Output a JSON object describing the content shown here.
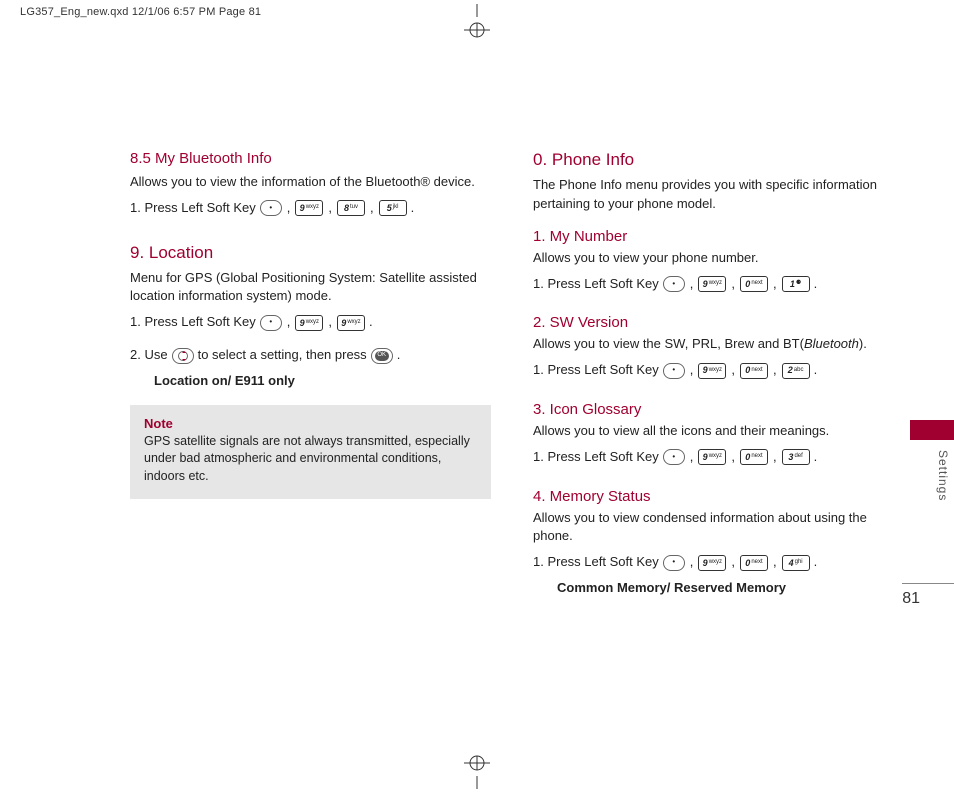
{
  "header": "LG357_Eng_new.qxd  12/1/06  6:57 PM  Page 81",
  "page_number": "81",
  "side_label": "Settings",
  "press_left": "1. Press Left Soft Key",
  "use_prefix": "2. Use",
  "use_suffix_a": "to select a setting, then press",
  "period": ".",
  "comma": ",",
  "left_col": {
    "s85": {
      "title": "8.5 My Bluetooth Info",
      "desc": "Allows you to view the information of the Bluetooth® device.",
      "keys": [
        "9 wxyz",
        "8 tuv",
        "5 jkl"
      ]
    },
    "s9": {
      "title": "9. Location",
      "desc": "Menu for GPS (Global Positioning System: Satellite assisted location information system) mode.",
      "keys1": [
        "9 wxyz",
        "9 wxyz"
      ],
      "opt_label": "Location on/ E911 only"
    },
    "note": {
      "label": "Note",
      "text": "GPS satellite signals are not always transmitted, especially under bad atmospheric and environmental conditions, indoors etc."
    }
  },
  "right_col": {
    "s0": {
      "title": "0. Phone Info",
      "desc": "The Phone Info menu provides you with specific information pertaining to your phone model."
    },
    "s1": {
      "title": "1. My Number",
      "desc": "Allows you to view your phone number.",
      "keys": [
        "9 wxyz",
        "0 next",
        "1 ⚈"
      ]
    },
    "s2": {
      "title": "2. SW Version",
      "desc_a": "Allows you to view the SW, PRL, Brew and BT(",
      "desc_b": "Bluetooth",
      "desc_c": ").",
      "keys": [
        "9 wxyz",
        "0 next",
        "2 abc"
      ]
    },
    "s3": {
      "title": "3. Icon Glossary",
      "desc": "Allows you to view all the icons and their meanings.",
      "keys": [
        "9 wxyz",
        "0 next",
        "3 def"
      ]
    },
    "s4": {
      "title": "4. Memory Status",
      "desc": "Allows you to view condensed information about using the phone.",
      "keys": [
        "9 wxyz",
        "0 next",
        "4 ghi"
      ],
      "opt_label": "Common Memory/ Reserved Memory"
    }
  }
}
